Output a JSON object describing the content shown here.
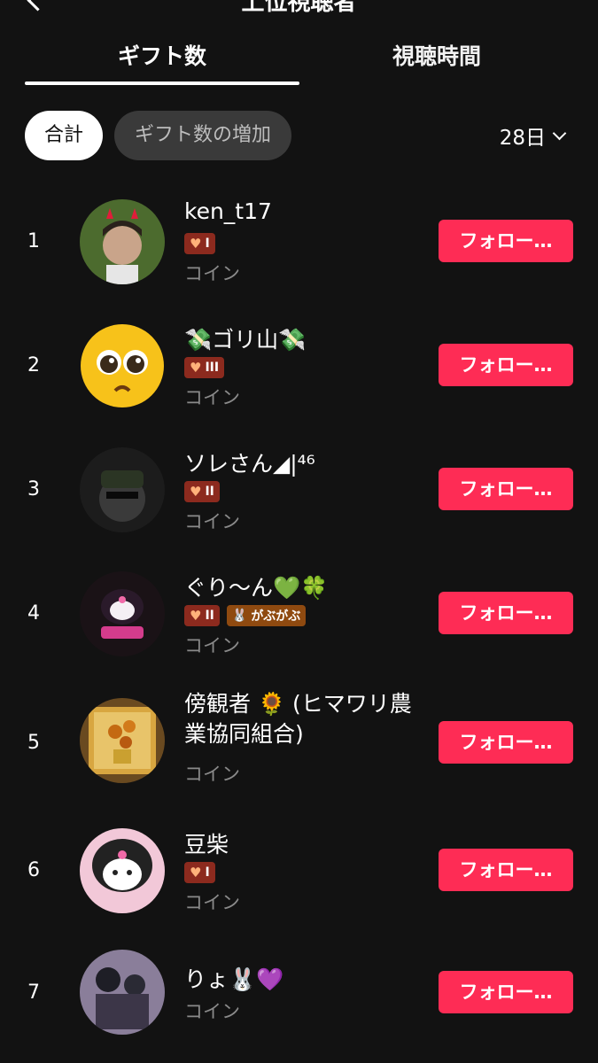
{
  "header": {
    "title": "上位視聴者"
  },
  "tabs": [
    {
      "label": "ギフト数"
    },
    {
      "label": "視聴時間"
    }
  ],
  "filters": {
    "total": "合計",
    "increase": "ギフト数の増加",
    "period": "28日"
  },
  "viewers": [
    {
      "rank": "1",
      "name": "ken_t17",
      "level": "I",
      "coin_label": "コイン",
      "follow_label": "フォロー…"
    },
    {
      "rank": "2",
      "name": "💸ゴリ山💸",
      "level": "III",
      "coin_label": "コイン",
      "follow_label": "フォロー…"
    },
    {
      "rank": "3",
      "name": "ソレさん◢|⁴⁶",
      "level": "II",
      "coin_label": "コイン",
      "follow_label": "フォロー…"
    },
    {
      "rank": "4",
      "name": "ぐり〜ん💚🍀",
      "level": "II",
      "fan_badge": "がぶがぶ",
      "coin_label": "コイン",
      "follow_label": "フォロー…"
    },
    {
      "rank": "5",
      "name": "傍観者 🌻 (ヒマワリ農業協同組合)",
      "coin_label": "コイン",
      "follow_label": "フォロー…"
    },
    {
      "rank": "6",
      "name": "豆柴",
      "level": "I",
      "coin_label": "コイン",
      "follow_label": "フォロー…"
    },
    {
      "rank": "7",
      "name": "りょ🐰💜",
      "coin_label": "コイン",
      "follow_label": "フォロー…"
    }
  ],
  "colors": {
    "follow": "#fe2c55",
    "background": "#121212"
  }
}
